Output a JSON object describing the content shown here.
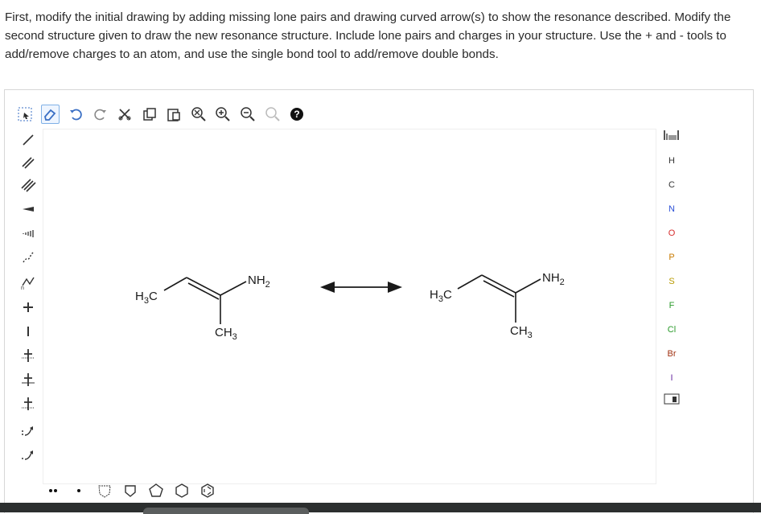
{
  "instructions": {
    "text": "First, modify the initial drawing by adding missing lone pairs and drawing curved arrow(s) to show the resonance described. Modify the second structure given to draw the new resonance structure. Include lone pairs and charges in your structure. Use the + and - tools to add/remove charges to an atom, and use the single bond tool to add/remove double bonds."
  },
  "toolbar": {
    "icons": [
      "select-icon",
      "eraser-icon",
      "undo-icon",
      "redo-icon",
      "cut-icon",
      "copy-icon",
      "paste-icon",
      "clear-zoom-icon",
      "zoom-in-icon",
      "zoom-out-icon",
      "color-icon",
      "help-icon"
    ]
  },
  "left_tools": [
    "single-bond-icon",
    "double-bond-icon",
    "triple-bond-icon",
    "wedge-bond-icon",
    "hash-bond-icon",
    "wavy-bond-icon",
    "chain-icon",
    "plus-charge-icon",
    "minus-charge-icon",
    "plus-minus-1-icon",
    "plus-minus-2-icon",
    "plus-minus-3-icon",
    "curved-arrow-single-icon",
    "curved-arrow-double-icon"
  ],
  "elements": {
    "periodic": "periodic-table-icon",
    "symbols": [
      "H",
      "C",
      "N",
      "O",
      "P",
      "S",
      "F",
      "Cl",
      "Br",
      "I"
    ],
    "colors": {
      "H": "#333333",
      "C": "#333333",
      "N": "#2b4fd6",
      "O": "#d62b2b",
      "P": "#c87a00",
      "S": "#b89a00",
      "F": "#2a9a2a",
      "Cl": "#2a9a2a",
      "Br": "#a03010",
      "I": "#6a2aa0"
    }
  },
  "molecule_left": {
    "ch3_label": "H",
    "ch3_sub": "3",
    "ch3_tail": "C",
    "nh2_label": "NH",
    "nh2_sub": "2",
    "ch3_bottom": "CH",
    "ch3_bottom_sub": "3"
  },
  "molecule_right": {
    "ch3_label": "H",
    "ch3_sub": "3",
    "ch3_tail": "C",
    "nh2_label": "NH",
    "nh2_sub": "2",
    "ch3_bottom": "CH",
    "ch3_bottom_sub": "3"
  },
  "bottom_tools": [
    "lone-pair-icon",
    "radical-icon",
    "ring-template-icon",
    "cyclopentane-icon",
    "pentagon-icon",
    "hexagon-icon",
    "benzene-icon"
  ]
}
